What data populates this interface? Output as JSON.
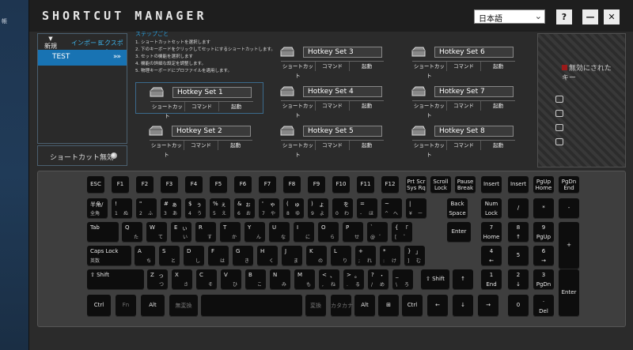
{
  "desktop": {
    "label": "帳"
  },
  "app": {
    "title": "SHORTCUT MANAGER",
    "help": "?",
    "minimize": "—",
    "close": "✕"
  },
  "language": {
    "selected": "日本語"
  },
  "sidebar": {
    "new_label": "新規",
    "import_label": "インポート",
    "export_label": "エクスポート",
    "sets": [
      {
        "name": "TEST"
      }
    ],
    "disable_shortcut_label": "ショートカット無効"
  },
  "steps": {
    "title": "ステップごと",
    "items": [
      "1. ショートカットセットを選択します",
      "2. 下のキーボードをクリックしてセットにするショートカットします。",
      "3. セットの機能を選択します",
      "4. 機能の詳細な設定を調整します。",
      "5. 物理キーボードにプロファイルを適用します。"
    ]
  },
  "hotkey_options": [
    "ショートカット",
    "コマンド",
    "起動"
  ],
  "hotkey_sets": [
    {
      "name": "Hotkey Set 1"
    },
    {
      "name": "Hotkey Set 2"
    },
    {
      "name": "Hotkey Set 3"
    },
    {
      "name": "Hotkey Set 4"
    },
    {
      "name": "Hotkey Set 5"
    },
    {
      "name": "Hotkey Set 6"
    },
    {
      "name": "Hotkey Set 7"
    },
    {
      "name": "Hotkey Set 8"
    }
  ],
  "disabled_keys": {
    "title": "無効にされたキー"
  },
  "keyboard": {
    "rows": [
      [
        {
          "l": "ESC"
        },
        {
          "l": "F1"
        },
        {
          "l": "F2"
        },
        {
          "l": "F3"
        },
        {
          "l": "F4"
        },
        {
          "l": "F5"
        },
        {
          "l": "F6"
        },
        {
          "l": "F7"
        },
        {
          "l": "F8"
        },
        {
          "l": "F9"
        },
        {
          "l": "F10"
        },
        {
          "l": "F11"
        },
        {
          "l": "F12"
        },
        {
          "l": "Prt Scr",
          "l2": "Sys Rq"
        },
        {
          "l": "Scroll",
          "l2": "Lock"
        },
        {
          "l": "Pause",
          "l2": "Break"
        },
        {
          "l": "Insert"
        },
        {
          "l": "Insert"
        },
        {
          "l": "PgUp",
          "l2": "Home"
        },
        {
          "l": "PgDn",
          "l2": "End"
        }
      ],
      [
        {
          "tl": "半角/",
          "bl": "全角"
        },
        {
          "tl": "!",
          "tr": "",
          "bl": "1",
          "br": "ぬ"
        },
        {
          "tl": "\"",
          "bl": "2",
          "br": "ふ"
        },
        {
          "tl": "#",
          "tr": "ぁ",
          "bl": "3",
          "br": "あ"
        },
        {
          "tl": "$",
          "tr": "ぅ",
          "bl": "4",
          "br": "う"
        },
        {
          "tl": "%",
          "tr": "ぇ",
          "bl": "5",
          "br": "え"
        },
        {
          "tl": "&",
          "tr": "ぉ",
          "bl": "6",
          "br": "お"
        },
        {
          "tl": "'",
          "tr": "ゃ",
          "bl": "7",
          "br": "や"
        },
        {
          "tl": "(",
          "tr": "ゅ",
          "bl": "8",
          "br": "ゆ"
        },
        {
          "tl": ")",
          "tr": "ょ",
          "bl": "9",
          "br": "よ"
        },
        {
          "tl": "",
          "tr": "を",
          "bl": "0",
          "br": "わ"
        },
        {
          "tl": "=",
          "bl": "-",
          "br": "ほ"
        },
        {
          "tl": "~",
          "bl": "^",
          "br": "へ"
        },
        {
          "tl": "|",
          "bl": "¥",
          "br": "ー"
        },
        {
          "l": "Back",
          "l2": "Space"
        },
        {
          "l": "Num",
          "l2": "Lock"
        },
        {
          "l": "/"
        },
        {
          "l": "*"
        },
        {
          "l": "-"
        }
      ],
      [
        {
          "tl": "Tab"
        },
        {
          "tl": "Q",
          "br": "た"
        },
        {
          "tl": "W",
          "br": "て"
        },
        {
          "tl": "E",
          "tr": "ぃ",
          "br": "い"
        },
        {
          "tl": "R",
          "br": "す"
        },
        {
          "tl": "T",
          "br": "か"
        },
        {
          "tl": "Y",
          "br": "ん"
        },
        {
          "tl": "U",
          "br": "な"
        },
        {
          "tl": "I",
          "br": "に"
        },
        {
          "tl": "O",
          "br": "ら"
        },
        {
          "tl": "P",
          "br": "せ"
        },
        {
          "tl": "`",
          "bl": "@",
          "br": "゛"
        },
        {
          "tl": "{",
          "tr": "「",
          "bl": "[",
          "br": "゜"
        },
        {
          "l": "Enter"
        },
        {
          "l": "7",
          "l2": "Home"
        },
        {
          "l": "8",
          "l2": "↑"
        },
        {
          "l": "9",
          "l2": "PgUp"
        },
        {
          "l": "+"
        }
      ],
      [
        {
          "tl": "Caps Lock",
          "bl": "英数"
        },
        {
          "tl": "A",
          "br": "ち"
        },
        {
          "tl": "S",
          "br": "と"
        },
        {
          "tl": "D",
          "br": "し"
        },
        {
          "tl": "F",
          "br": "は"
        },
        {
          "tl": "G",
          "br": "き"
        },
        {
          "tl": "H",
          "br": "く"
        },
        {
          "tl": "J",
          "br": "ま"
        },
        {
          "tl": "K",
          "br": "の"
        },
        {
          "tl": "L",
          "br": "り"
        },
        {
          "tl": "+",
          "bl": ";",
          "br": "れ"
        },
        {
          "tl": "*",
          "bl": ":",
          "br": "け"
        },
        {
          "tl": "}",
          "tr": "」",
          "bl": "]",
          "br": "む"
        },
        {
          "l": "4",
          "l2": "←"
        },
        {
          "l": "5"
        },
        {
          "l": "6",
          "l2": "→"
        }
      ],
      [
        {
          "tl": "⇧ Shift"
        },
        {
          "tl": "Z",
          "tr": "っ",
          "br": "つ"
        },
        {
          "tl": "X",
          "br": "さ"
        },
        {
          "tl": "C",
          "br": "そ"
        },
        {
          "tl": "V",
          "br": "ひ"
        },
        {
          "tl": "B",
          "br": "こ"
        },
        {
          "tl": "N",
          "br": "み"
        },
        {
          "tl": "M",
          "br": "も"
        },
        {
          "tl": "<",
          "tr": "、",
          "bl": ",",
          "br": "ね"
        },
        {
          "tl": ">",
          "tr": "。",
          "bl": ".",
          "br": "る"
        },
        {
          "tl": "?",
          "tr": "・",
          "bl": "/",
          "br": "め"
        },
        {
          "tl": "_",
          "bl": "\\",
          "br": "ろ"
        },
        {
          "l": "⇧ Shift"
        },
        {
          "l": "↑"
        },
        {
          "l": "1",
          "l2": "End"
        },
        {
          "l": "2",
          "l2": "↓"
        },
        {
          "l": "3",
          "l2": "PgDn"
        },
        {
          "l": "Enter"
        }
      ],
      [
        {
          "l": "Ctrl"
        },
        {
          "l": "Fn"
        },
        {
          "l": "Alt"
        },
        {
          "l": "無変換"
        },
        {
          "l": ""
        },
        {
          "l": "変換"
        },
        {
          "l": "カタカナ"
        },
        {
          "l": "Alt"
        },
        {
          "l": "⊞"
        },
        {
          "l": "Ctrl"
        },
        {
          "l": "←"
        },
        {
          "l": "↓"
        },
        {
          "l": "→"
        },
        {
          "l": "0"
        },
        {
          "l": ".",
          "l2": "Del"
        }
      ]
    ]
  }
}
